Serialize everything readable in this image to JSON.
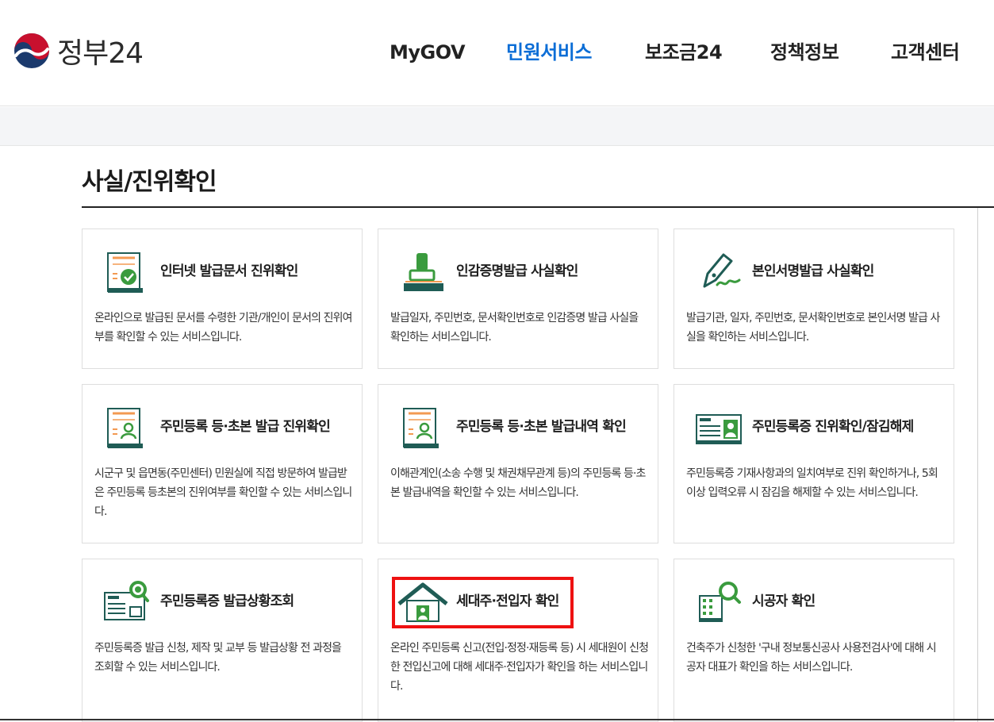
{
  "header": {
    "logo_text": "정부24",
    "nav": [
      {
        "label": "MyGOV",
        "active": false
      },
      {
        "label": "민원서비스",
        "active": true
      },
      {
        "label": "보조금24",
        "active": false
      },
      {
        "label": "정책정보",
        "active": false
      },
      {
        "label": "고객센터",
        "active": false
      }
    ]
  },
  "page": {
    "title": "사실/진위확인"
  },
  "cards": [
    {
      "title": "인터넷 발급문서 진위확인",
      "desc": "온라인으로 발급된 문서를 수령한 기관/개인이 문서의 진위여부를 확인할 수 있는 서비스입니다.",
      "icon": "document-check-icon"
    },
    {
      "title": "인감증명발급 사실확인",
      "desc": "발급일자, 주민번호, 문서확인번호로 인감증명 발급 사실을 확인하는 서비스입니다.",
      "icon": "stamp-icon"
    },
    {
      "title": "본인서명발급 사실확인",
      "desc": "발급기관, 일자, 주민번호, 문서확인번호로 본인서명 발급 사실을 확인하는 서비스입니다.",
      "icon": "pen-signature-icon"
    },
    {
      "title": "주민등록 등·초본 발급 진위확인",
      "desc": "시군구 및 읍면동(주민센터) 민원실에 직접 방문하여 발급받은 주민등록 등초본의 진위여부를 확인할 수 있는 서비스입니다.",
      "icon": "document-person-icon"
    },
    {
      "title": "주민등록 등·초본 발급내역 확인",
      "desc": "이해관계인(소송 수행 및 채권채무관계 등)의 주민등록 등·초본 발급내역을 확인할 수 있는 서비스입니다.",
      "icon": "document-person-icon"
    },
    {
      "title": "주민등록증 진위확인/잠김해제",
      "desc": "주민등록증 기재사항과의 일치여부로 진위 확인하거나, 5회 이상 입력오류 시 잠김을 해제할 수 있는 서비스입니다.",
      "icon": "id-card-icon"
    },
    {
      "title": "주민등록증 발급상황조회",
      "desc": "주민등록증 발급 신청, 제작 및 교부 등 발급상황 전 과정을 조회할 수 있는 서비스입니다.",
      "icon": "id-card-search-icon"
    },
    {
      "title": "세대주·전입자 확인",
      "desc": "온라인 주민등록 신고(전입·정정·재등록 등) 시 세대원이 신청한 전입신고에 대해 세대주·전입자가 확인을 하는 서비스입니다.",
      "icon": "house-person-icon"
    },
    {
      "title": "시공자 확인",
      "desc": "건축주가 신청한 '구내 정보통신공사 사용전검사'에 대해 시공자 대표가 확인을 하는 서비스입니다.",
      "icon": "building-search-icon"
    }
  ],
  "colors": {
    "accent_blue": "#0b6dd6",
    "icon_orange": "#f39a52",
    "icon_teal": "#1f5c55",
    "icon_green": "#3a9b3e",
    "highlight_red": "#ee1111"
  }
}
